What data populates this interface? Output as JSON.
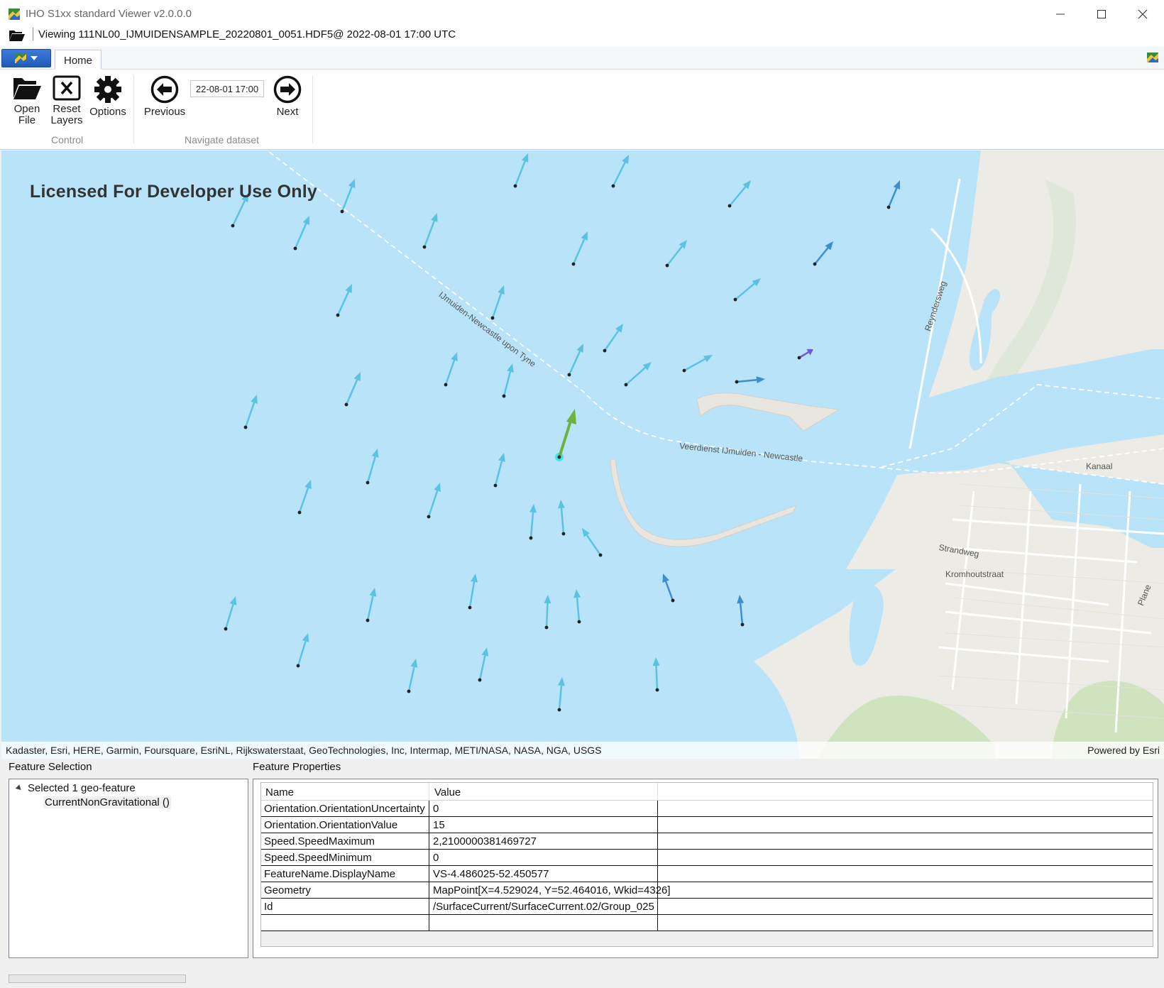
{
  "window": {
    "title": "IHO S1xx standard Viewer v2.0.0.0",
    "viewing": "Viewing 111NL00_IJMUIDENSAMPLE_20220801_0051.HDF5@ 2022-08-01 17:00 UTC"
  },
  "ribbon": {
    "tab_home": "Home",
    "open_file_l1": "Open",
    "open_file_l2": "File",
    "reset_layers_l1": "Reset",
    "reset_layers_l2": "Layers",
    "options": "Options",
    "group_control": "Control",
    "previous": "Previous",
    "date_value": "22-08-01 17:00",
    "next": "Next",
    "group_navigate": "Navigate dataset"
  },
  "map": {
    "license": "Licensed For Developer Use Only",
    "attribution": "Kadaster, Esri, HERE, Garmin, Foursquare, EsriNL, Rijkswaterstaat, GeoTechnologies, Inc, Intermap, METI/NASA, NASA, NGA, USGS",
    "powered_by": "Powered by Esri",
    "labels": {
      "ferry_route_1": "IJmuiden-Newcastle upon Tyne",
      "ferry_route_2": "Veerdienst IJmuiden - Newcastle",
      "street_reyndersweg": "Reyndersweg",
      "street_strandweg": "Strandweg",
      "street_kromhoutstraat": "Kromhoutstraat",
      "kanaal": "Kanaal",
      "plane": "Plane"
    },
    "colors": {
      "water": "#b8e3f8",
      "arrow": "#5bc3e2",
      "arrow_dark": "#3d8ed0",
      "arrow_purple": "#6b5bd8",
      "selected_arrow": "#6cb33f"
    }
  },
  "feature_selection": {
    "title": "Feature Selection",
    "root": "Selected 1 geo-feature",
    "child": "CurrentNonGravitational ()"
  },
  "feature_properties": {
    "title": "Feature Properties",
    "columns": [
      "Name",
      "Value"
    ],
    "rows": [
      {
        "name": "Orientation.OrientationUncertainty",
        "value": "0"
      },
      {
        "name": "Orientation.OrientationValue",
        "value": "15"
      },
      {
        "name": "Speed.SpeedMaximum",
        "value": "2,2100000381469727"
      },
      {
        "name": "Speed.SpeedMinimum",
        "value": "0"
      },
      {
        "name": "FeatureName.DisplayName",
        "value": "VS-4.486025-52.450577"
      },
      {
        "name": "Geometry",
        "value": "MapPoint[X=4.529024, Y=52.464016, Wkid=4326]"
      },
      {
        "name": "Id",
        "value": "/SurfaceCurrent/SurfaceCurrent.02/Group_025"
      },
      {
        "name": "",
        "value": ""
      }
    ]
  }
}
